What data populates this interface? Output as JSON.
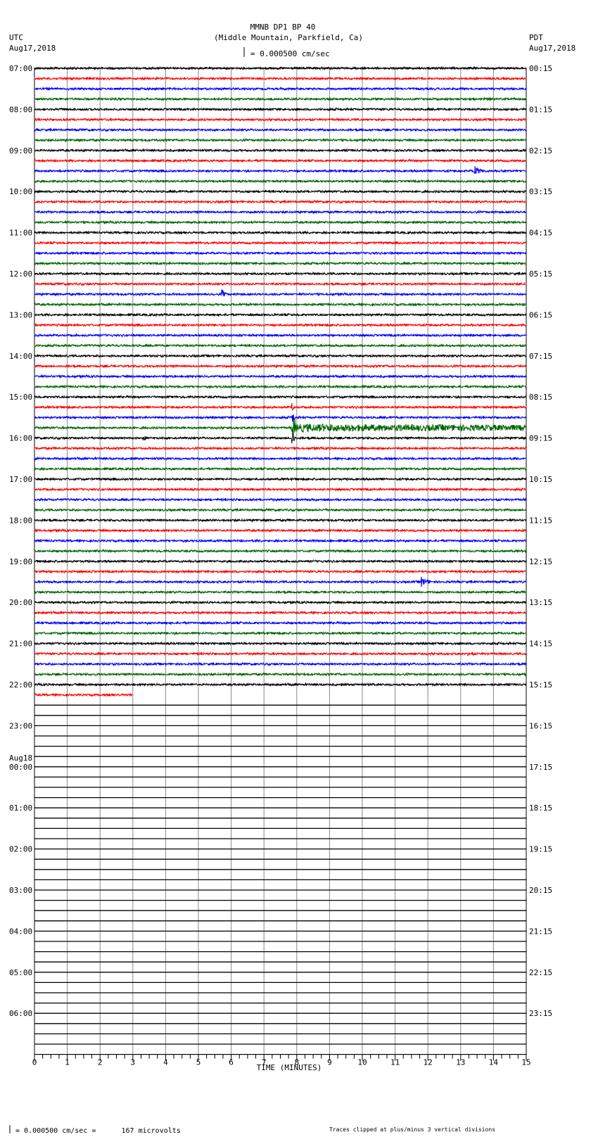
{
  "chart_data": {
    "type": "line",
    "title": "MMNB DP1 BP 40",
    "subtitle": "(Middle Mountain, Parkfield, Ca)",
    "left_timezone": "UTC",
    "left_date": "Aug17,2018",
    "right_timezone": "PDT",
    "right_date": "Aug17,2018",
    "scale_label": "= 0.000500 cm/sec",
    "xlabel": "TIME (MINUTES)",
    "xlim": [
      0,
      15
    ],
    "x_ticks": [
      "0",
      "1",
      "2",
      "3",
      "4",
      "5",
      "6",
      "7",
      "8",
      "9",
      "10",
      "11",
      "12",
      "13",
      "14",
      "15"
    ],
    "rows_per_hour": 4,
    "total_rows": 96,
    "trace_colors": [
      "#000000",
      "#ff0000",
      "#0000ff",
      "#006400"
    ],
    "left_hour_labels": [
      "07:00",
      "08:00",
      "09:00",
      "10:00",
      "11:00",
      "12:00",
      "13:00",
      "14:00",
      "15:00",
      "16:00",
      "17:00",
      "18:00",
      "19:00",
      "20:00",
      "21:00",
      "22:00",
      "23:00",
      "00:00",
      "01:00",
      "02:00",
      "03:00",
      "04:00",
      "05:00",
      "06:00"
    ],
    "date_change_label": "Aug18",
    "date_change_hour_index": 17,
    "right_hour_labels": [
      "00:15",
      "01:15",
      "02:15",
      "03:15",
      "04:15",
      "05:15",
      "06:15",
      "07:15",
      "08:15",
      "09:15",
      "10:15",
      "11:15",
      "12:15",
      "13:15",
      "14:15",
      "15:15",
      "16:15",
      "17:15",
      "18:15",
      "19:15",
      "20:15",
      "21:15",
      "22:15",
      "23:15"
    ],
    "data_full_rows": 61,
    "last_row_minutes": 3,
    "events": [
      {
        "row": 10,
        "minute": 13.4,
        "amplitude": 1.0,
        "duration": 0.4
      },
      {
        "row": 22,
        "minute": 5.7,
        "amplitude": 1.0,
        "duration": 0.15
      },
      {
        "row": 33,
        "minute": 7.85,
        "amplitude": 0.8,
        "duration": 0.1
      },
      {
        "row": 34,
        "minute": 7.85,
        "amplitude": 1.2,
        "duration": 0.1
      },
      {
        "row": 35,
        "minute": 7.85,
        "amplitude": 3.0,
        "duration": 7.15,
        "coda": true
      },
      {
        "row": 36,
        "minute": 7.85,
        "amplitude": 1.5,
        "duration": 0.1
      },
      {
        "row": 36,
        "minute": 3.3,
        "amplitude": 0.5,
        "duration": 0.3
      },
      {
        "row": 50,
        "minute": 11.8,
        "amplitude": 1.0,
        "duration": 0.3
      },
      {
        "row": 57,
        "minute": 13.2,
        "amplitude": 0.4,
        "duration": 0.5
      }
    ],
    "footer_scale": "= 0.000500 cm/sec =      167 microvolts",
    "footer_note": "Traces clipped at plus/minus 3 vertical divisions"
  }
}
